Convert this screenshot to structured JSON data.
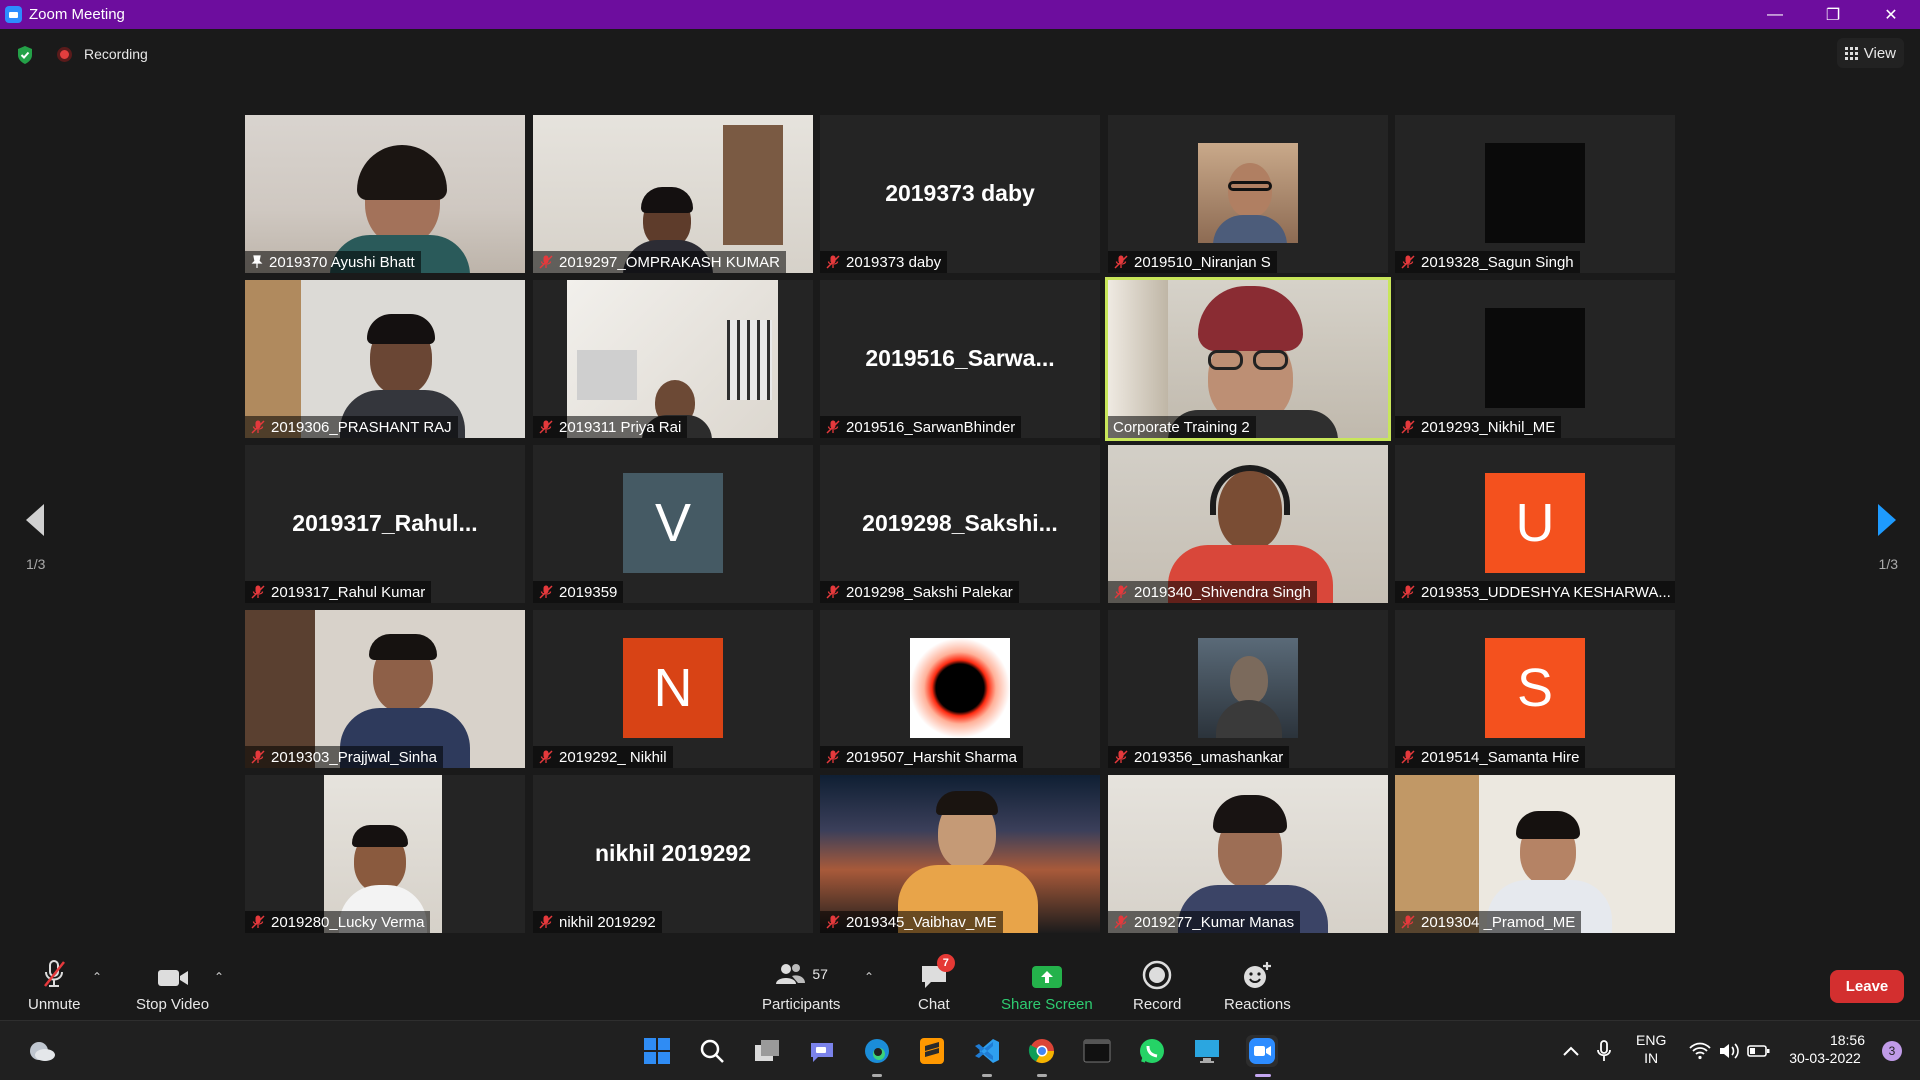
{
  "window": {
    "title": "Zoom Meeting"
  },
  "topbar": {
    "recording_label": "Recording",
    "view_label": "View"
  },
  "pagination": {
    "left": "1/3",
    "right": "1/3"
  },
  "tiles": [
    {
      "name": "2019370 Ayushi Bhatt",
      "pinned": true
    },
    {
      "name": "2019297_OMPRAKASH KUMAR"
    },
    {
      "name": "2019373 daby",
      "center": "2019373 daby"
    },
    {
      "name": "2019510_Niranjan S"
    },
    {
      "name": "2019328_Sagun Singh"
    },
    {
      "name": "2019306_PRASHANT RAJ"
    },
    {
      "name": "2019311 Priya Rai"
    },
    {
      "name": "2019516_SarwanBhinder",
      "center": "2019516_Sarwa..."
    },
    {
      "name": "Corporate Training 2"
    },
    {
      "name": "2019293_Nikhil_ME"
    },
    {
      "name": "2019317_Rahul Kumar",
      "center": "2019317_Rahul..."
    },
    {
      "name": "2019359",
      "avatar": "V"
    },
    {
      "name": "2019298_Sakshi Palekar",
      "center": "2019298_Sakshi..."
    },
    {
      "name": "2019340_Shivendra Singh"
    },
    {
      "name": "2019353_UDDESHYA KESHARWA...",
      "avatar": "U"
    },
    {
      "name": "2019303_Prajjwal_Sinha"
    },
    {
      "name": "2019292_ Nikhil",
      "avatar": "N"
    },
    {
      "name": "2019507_Harshit Sharma"
    },
    {
      "name": "2019356_umashankar"
    },
    {
      "name": "2019514_Samanta Hire",
      "avatar": "S"
    },
    {
      "name": "2019280_Lucky Verma"
    },
    {
      "name": "nikhil 2019292",
      "center": "nikhil 2019292"
    },
    {
      "name": "2019345_Vaibhav_ME"
    },
    {
      "name": "2019277_Kumar Manas"
    },
    {
      "name": "2019304 _Pramod_ME"
    }
  ],
  "toolbar": {
    "unmute": "Unmute",
    "stop_video": "Stop Video",
    "participants": "Participants",
    "participants_count": "57",
    "chat": "Chat",
    "chat_badge": "7",
    "share_screen": "Share Screen",
    "record": "Record",
    "reactions": "Reactions",
    "leave": "Leave"
  },
  "taskbar": {
    "lang_top": "ENG",
    "lang_bottom": "IN",
    "time": "18:56",
    "date": "30-03-2022",
    "notifications": "3"
  },
  "colors": {
    "titlebar": "#6d0d9e",
    "active_speaker": "#c8e65a",
    "avatar_v": "#455a64",
    "avatar_u": "#f4511e",
    "avatar_n": "#d84315",
    "avatar_s": "#f4511e",
    "share_green": "#2ecc71",
    "leave_red": "#d32f2f"
  }
}
